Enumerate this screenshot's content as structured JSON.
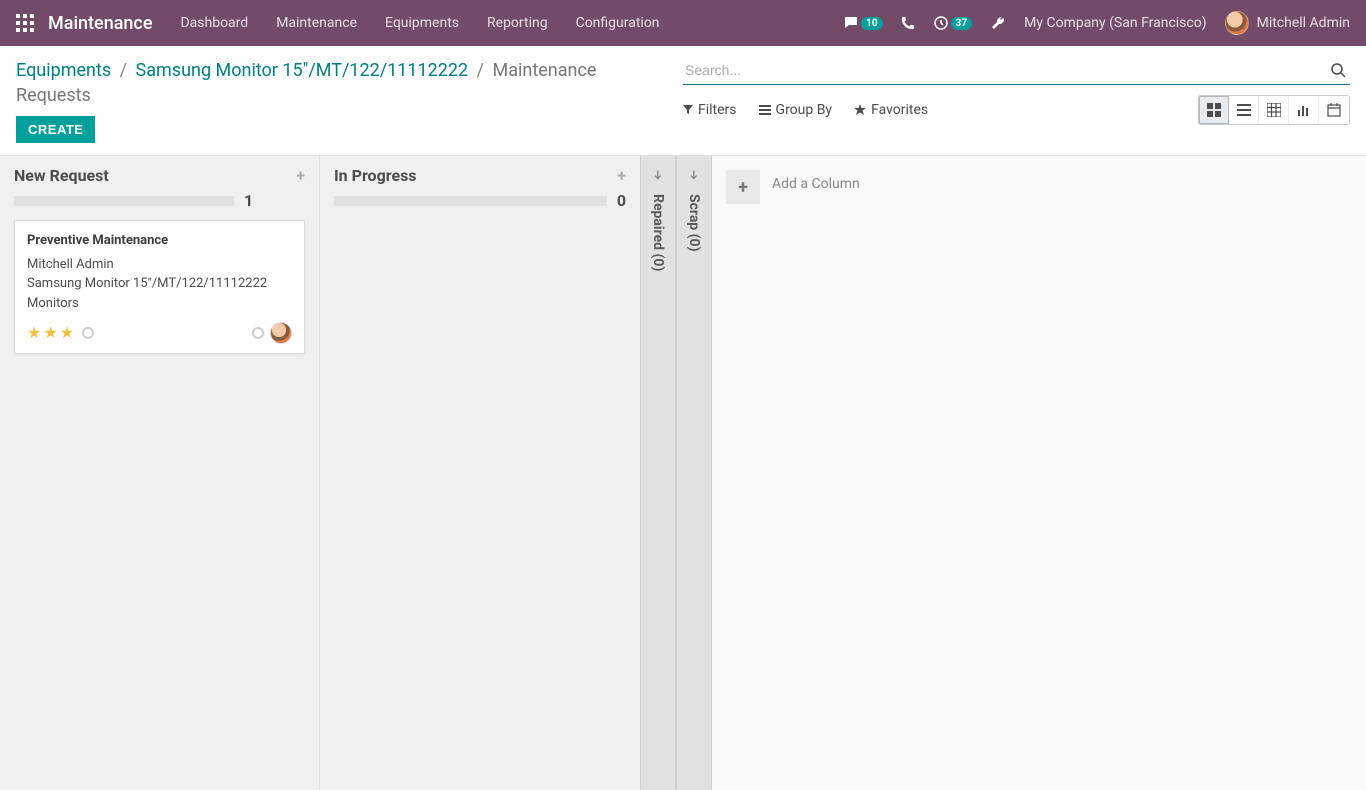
{
  "topbar": {
    "app_title": "Maintenance",
    "menu": [
      "Dashboard",
      "Maintenance",
      "Equipments",
      "Reporting",
      "Configuration"
    ],
    "messages_badge": "10",
    "activities_badge": "37",
    "company": "My Company (San Francisco)",
    "user": "Mitchell Admin"
  },
  "breadcrumb": {
    "root": "Equipments",
    "item": "Samsung Monitor 15\"/MT/122/11112222",
    "current": "Maintenance Requests"
  },
  "buttons": {
    "create": "CREATE"
  },
  "search": {
    "placeholder": "Search...",
    "filters": "Filters",
    "group_by": "Group By",
    "favorites": "Favorites"
  },
  "kanban": {
    "columns": [
      {
        "title": "New Request",
        "count": "1"
      },
      {
        "title": "In Progress",
        "count": "0"
      }
    ],
    "folded": [
      {
        "label": "Repaired (0)"
      },
      {
        "label": "Scrap (0)"
      }
    ],
    "add_column": "Add a Column"
  },
  "card": {
    "title": "Preventive Maintenance",
    "user": "Mitchell Admin",
    "equipment": "Samsung Monitor 15\"/MT/122/11112222",
    "category": "Monitors",
    "stars": 3
  }
}
